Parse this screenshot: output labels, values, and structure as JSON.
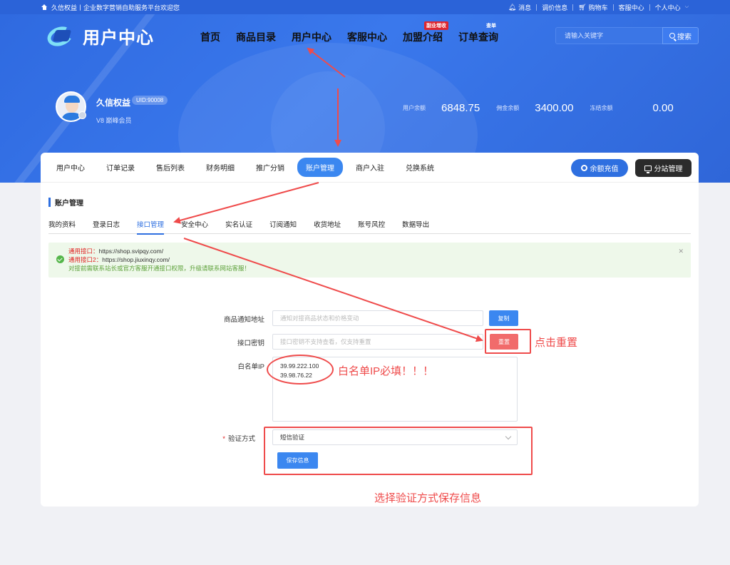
{
  "topbar": {
    "welcome": "久信权益丨企业数字营销自助服务平台欢迎您",
    "links": [
      {
        "icon": "bell-icon",
        "label": "消息"
      },
      {
        "icon": "",
        "label": "调价信息"
      },
      {
        "icon": "cart-icon",
        "label": "购物车"
      },
      {
        "icon": "",
        "label": "客服中心"
      },
      {
        "icon": "",
        "label": "个人中心"
      }
    ]
  },
  "header": {
    "logo_text": "用户中心",
    "nav": [
      {
        "label": "首页",
        "badge": ""
      },
      {
        "label": "商品目录",
        "badge": ""
      },
      {
        "label": "用户中心",
        "badge": ""
      },
      {
        "label": "客服中心",
        "badge": ""
      },
      {
        "label": "加盟介绍",
        "badge": "副业增收"
      },
      {
        "label": "订单查询",
        "badge": "查单"
      }
    ],
    "search": {
      "placeholder": "请输入关键字",
      "button": "搜索"
    }
  },
  "profile": {
    "name": "久信权益",
    "uid": "UID:90008",
    "level": "V8 巅峰会员",
    "balances": [
      {
        "label": "用户余额",
        "value": "6848.75"
      },
      {
        "label": "佣金余额",
        "value": "3400.00"
      },
      {
        "label": "冻结余额",
        "value": "0.00"
      }
    ]
  },
  "subnav": {
    "items": [
      "用户中心",
      "订单记录",
      "售后列表",
      "财务明细",
      "推广分销",
      "账户管理",
      "商户入驻",
      "兑换系统"
    ],
    "active_index": 5,
    "recharge": "余额充值",
    "branch": "分站管理"
  },
  "account": {
    "title": "账户管理",
    "tabs": [
      "我的资料",
      "登录日志",
      "接口管理",
      "安全中心",
      "实名认证",
      "订阅通知",
      "收货地址",
      "账号风控",
      "数据导出"
    ],
    "active_tab": 2,
    "notice": {
      "line1_label": "通用接口：",
      "line1_value": "https://shop.svipqy.com/",
      "line2_label": "通用接口2：",
      "line2_value": "https://shop.jiuxinqy.com/",
      "line3": "对接前需联系站长或官方客服开通接口权限，升级请联系网站客服！"
    },
    "form": {
      "notify_label": "商品通知地址",
      "notify_placeholder": "通知对接商品状态和价格变动",
      "copy_button": "复制",
      "key_label": "接口密钥",
      "key_placeholder": "接口密钥不支持查看，仅支持重置",
      "reset_button": "重置",
      "whitelist_label": "白名单IP",
      "whitelist_value": "39.99.222.100\n39.98.76.22",
      "verify_label": "验证方式",
      "verify_value": "短信验证",
      "save_button": "保存信息"
    }
  },
  "annotations": {
    "reset_hint": "点击重置",
    "whitelist_hint": "白名单IP必填！！！",
    "save_hint": "选择验证方式保存信息",
    "color": "#ef4b4b"
  },
  "colors": {
    "brand": "#2e6fe0",
    "hero": "#3a78ec",
    "active_tab": "#3b87f0",
    "reset": "#f16b6b",
    "notice_bg": "#eef8ea"
  }
}
